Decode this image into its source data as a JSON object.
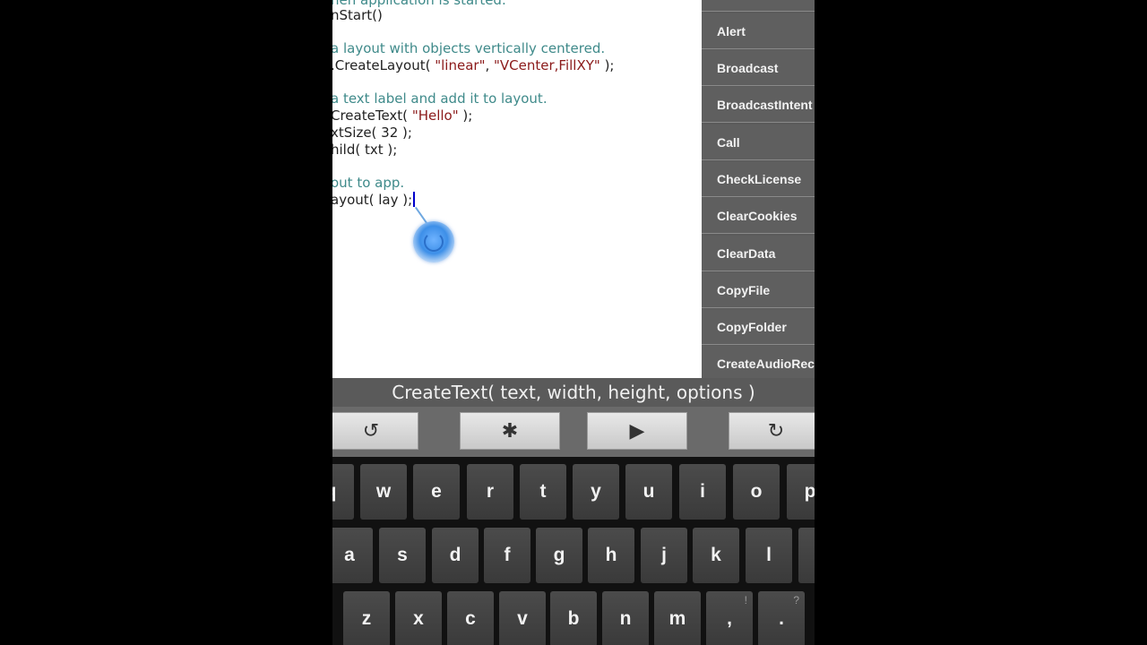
{
  "editor": {
    "lines": [
      {
        "text": "hen application is started.",
        "type": "comment"
      },
      {
        "text": "nStart()",
        "type": "code"
      },
      {
        "text": "",
        "type": "blank"
      },
      {
        "text": "a layout with objects vertically centered.",
        "type": "comment"
      },
      {
        "text": ".CreateLayout( ",
        "type": "code",
        "str1": "\"linear\"",
        "mid": ", ",
        "str2": "\"VCenter,FillXY\"",
        "tail": " );"
      },
      {
        "text": "",
        "type": "blank"
      },
      {
        "text": "a text label and add it to layout.",
        "type": "comment"
      },
      {
        "text": "CreateText( ",
        "type": "code",
        "str1": "\"Hello\"",
        "tail": " );"
      },
      {
        "text": "xtSize( 32 );",
        "type": "code"
      },
      {
        "text": "hild( txt );",
        "type": "code"
      },
      {
        "text": "",
        "type": "blank"
      },
      {
        "text": "out to app.",
        "type": "comment"
      },
      {
        "text": "ayout( lay );",
        "type": "code"
      }
    ]
  },
  "method_list": {
    "items": [
      "Alert",
      "Broadcast",
      "BroadcastIntent",
      "Call",
      "CheckLicense",
      "ClearCookies",
      "ClearData",
      "CopyFile",
      "CopyFolder",
      "CreateAudioRecorder"
    ]
  },
  "hint_bar": {
    "text": "CreateText( text, width, height, options )"
  },
  "toolbar": {
    "undo_icon": "undo-icon",
    "undo_glyph": "↺",
    "debug_icon": "bug-icon",
    "debug_glyph": "✱",
    "run_icon": "play-icon",
    "run_glyph": "▶",
    "redo_icon": "redo-icon",
    "redo_glyph": "↻"
  },
  "keyboard": {
    "row1": [
      "q",
      "w",
      "e",
      "r",
      "t",
      "y",
      "u",
      "i",
      "o",
      "p"
    ],
    "row2": [
      "a",
      "s",
      "d",
      "f",
      "g",
      "h",
      "j",
      "k",
      "l"
    ],
    "row3": [
      "z",
      "x",
      "c",
      "v",
      "b",
      "n",
      "m",
      ",",
      "."
    ],
    "row3_hints": {
      ",": "!",
      ".": "?"
    }
  },
  "colors": {
    "comment": "#3f8a8a",
    "string": "#8b1a1a",
    "list_bg": "#5f5f5f",
    "accent_touch": "#3d8fe8"
  }
}
